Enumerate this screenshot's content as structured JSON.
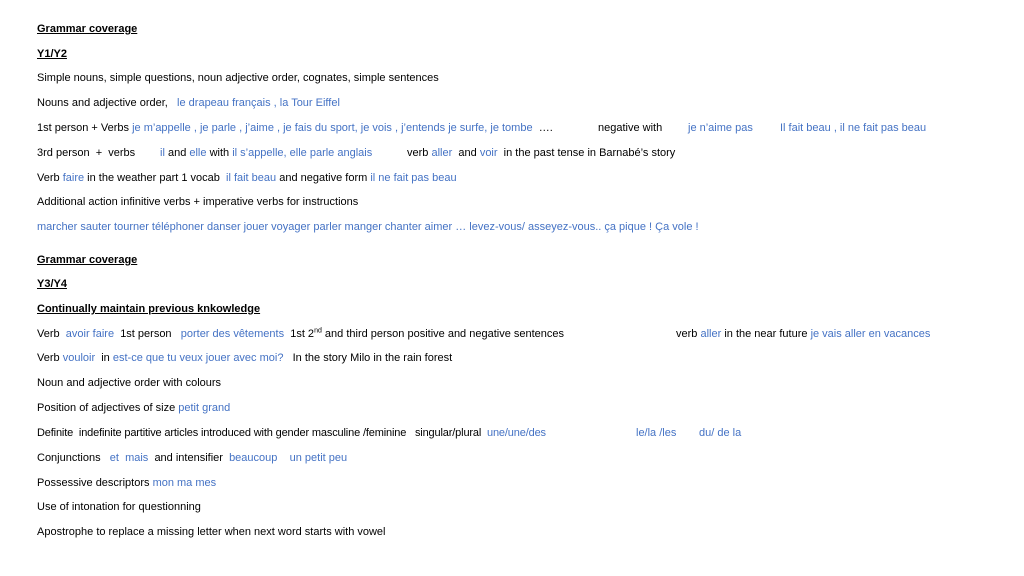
{
  "colors": {
    "text": "#000000",
    "french_example": "#4472C4",
    "background": "#ffffff"
  },
  "section_y1y2": {
    "heading": "Grammar coverage",
    "year": "Y1/Y2",
    "lines": {
      "simple": "Simple nouns, simple questions, noun adjective order, cognates, simple sentences",
      "nouns_adj": {
        "text": "Nouns and adjective order,",
        "example": "le drapeau français , la Tour Eiffel"
      },
      "first_person": {
        "text": "1st person + Verbs",
        "example": "je m’appelle , je parle , j’aime , je fais du sport, je vois , j’entends je surfe, je tombe",
        "ellipsis": "….",
        "negative_label": "negative with",
        "negative_example1": "je n’aime pas",
        "negative_example2": "Il fait beau , il ne fait pas beau"
      },
      "third_person": {
        "text": "3rd person  +  verbs",
        "il": "il",
        "and": "and",
        "elle": "elle",
        "with": "with",
        "example": "il s’appelle, elle parle anglais",
        "verb_label": "verb",
        "aller": "aller",
        "and2": "and",
        "voir": "voir",
        "tail": "in the past tense in Barnabé’s story"
      },
      "faire": {
        "verb": "Verb",
        "faire": "faire",
        "mid": "in the weather part 1 vocab",
        "example1": "il fait beau",
        "mid2": "and negative form",
        "example2": "il ne fait pas beau"
      },
      "additional": "Additional action infinitive verbs + imperative verbs for instructions",
      "verb_list": "marcher sauter tourner téléphoner danser jouer voyager parler manger chanter aimer … levez-vous/ asseyez-vous.. ça pique ! Ça vole !"
    }
  },
  "section_y3y4": {
    "heading": "Grammar coverage",
    "year": "Y3/Y4",
    "subheading": "Continually maintain previous knkowledge",
    "lines": {
      "avoir_faire": {
        "verb": "Verb",
        "example": "avoir faire",
        "first_person": "1st person",
        "example2": "porter des vêtements",
        "tail_a": "1st 2",
        "tail_sup": "nd",
        "tail_b": " and third person positive and negative sentences",
        "near_future_verb": "verb",
        "aller": "aller",
        "near_future_text": "in the near future",
        "near_future_example": "je vais aller en vacances"
      },
      "vouloir": {
        "verb": "Verb",
        "vouloir": "vouloir",
        "in": "in",
        "example": "est-ce que tu veux jouer avec moi?",
        "tail": "In the story Milo in the rain forest"
      },
      "colours": "Noun and adjective order with colours",
      "size": {
        "text": "Position of adjectives of size",
        "example": "petit grand"
      },
      "articles": {
        "text": "Definite  indefinite partitive articles introduced with gender masculine /feminine   singular/plural",
        "example1": "une/une/des",
        "example2": "le/la /les",
        "example3": "du/ de la"
      },
      "conjunctions": {
        "text": "Conjunctions",
        "et": "et",
        "mais": "mais",
        "mid": "and intensifier",
        "beaucoup": "beaucoup",
        "petit_peu": "un petit peu"
      },
      "possessive": {
        "text": "Possessive descriptors",
        "example": "mon ma mes"
      },
      "intonation": "Use of intonation for questionning",
      "apostrophe": "Apostrophe to replace a missing letter when next word starts with vowel"
    }
  }
}
